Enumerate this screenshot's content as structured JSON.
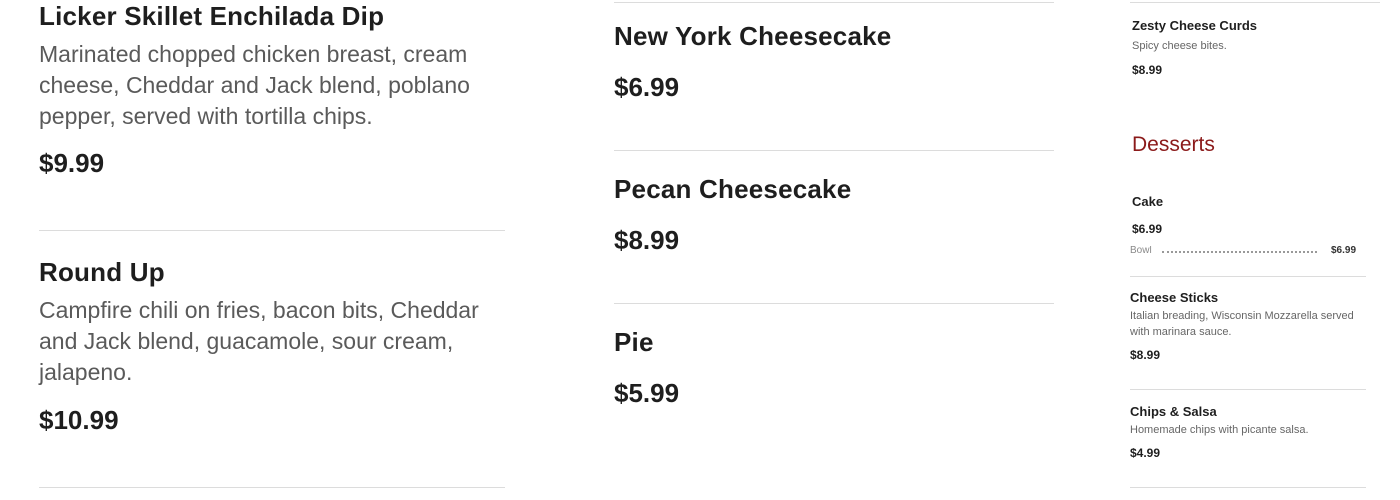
{
  "left": {
    "items": [
      {
        "title": "Licker Skillet Enchilada Dip",
        "description": "Marinated chopped chicken breast, cream cheese, Cheddar and Jack blend, poblano pepper, served with tortilla chips.",
        "price": "$9.99"
      },
      {
        "title": "Round Up",
        "description": "Campfire chili on fries, bacon bits, Cheddar and Jack blend, guacamole, sour cream, jalapeno.",
        "price": "$10.99"
      }
    ]
  },
  "middle": {
    "items": [
      {
        "title": "New York Cheesecake",
        "price": "$6.99"
      },
      {
        "title": "Pecan Cheesecake",
        "price": "$8.99"
      },
      {
        "title": "Pie",
        "price": "$5.99"
      }
    ]
  },
  "right": {
    "top_item": {
      "title": "Zesty Cheese Curds",
      "description": "Spicy cheese bites.",
      "price": "$8.99"
    },
    "section_title": "Desserts",
    "cake_item": {
      "title": "Cake",
      "price": "$6.99"
    },
    "bowl_row": {
      "label": "Bowl",
      "price": "$6.99"
    },
    "items": [
      {
        "title": "Cheese Sticks",
        "description": "Italian breading, Wisconsin Mozzarella served with marinara sauce.",
        "price": "$8.99"
      },
      {
        "title": "Chips & Salsa",
        "description": "Homemade chips with picante salsa.",
        "price": "$4.99"
      }
    ]
  },
  "colors": {
    "section_heading": "#8b1a1a",
    "description_text": "#5a5a5a",
    "divider": "#dcdcdc"
  }
}
